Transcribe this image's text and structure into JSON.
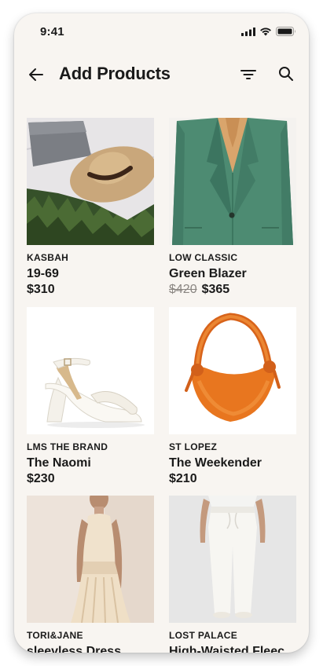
{
  "status_bar": {
    "time": "9:41"
  },
  "header": {
    "title": "Add Products"
  },
  "products": [
    {
      "brand": "KASBAH",
      "name": "19-69",
      "price": "$310",
      "old_price": ""
    },
    {
      "brand": "LOW CLASSIC",
      "name": "Green Blazer",
      "price": "$365",
      "old_price": "$420"
    },
    {
      "brand": "LMS THE BRAND",
      "name": "The Naomi",
      "price": "$230",
      "old_price": ""
    },
    {
      "brand": "ST LOPEZ",
      "name": "The Weekender",
      "price": "$210",
      "old_price": ""
    },
    {
      "brand": "TORI&JANE",
      "name": "sleevless Dress",
      "price": "",
      "old_price": ""
    },
    {
      "brand": "LOST PALACE",
      "name": "High-Waisted Fleec",
      "price": "",
      "old_price": ""
    }
  ],
  "colors": {
    "background": "#f8f5f1",
    "text": "#1a1a1a",
    "muted": "#8a8682"
  }
}
